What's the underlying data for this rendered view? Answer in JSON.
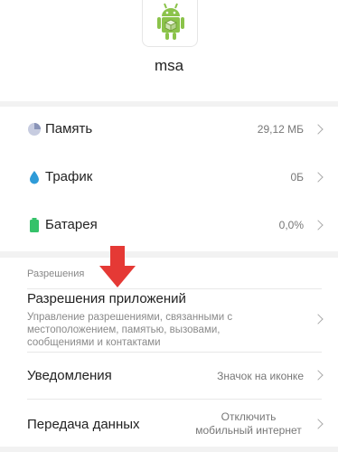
{
  "app": {
    "name": "msa",
    "icon": "android-icon"
  },
  "storage_rows": [
    {
      "label": "Память",
      "value": "29,12 МБ",
      "icon": "pie-chart-icon",
      "color": "#8a94b8"
    },
    {
      "label": "Трафик",
      "value": "0Б",
      "icon": "drop-icon",
      "color": "#2e9bd8"
    },
    {
      "label": "Батарея",
      "value": "0,0%",
      "icon": "battery-icon",
      "color": "#35c26a"
    }
  ],
  "permissions": {
    "section_title": "Разрешения",
    "title": "Разрешения приложений",
    "description": "Управление разрешениями, связанными с местоположением, памятью, вызовами, сообщениями и контактами"
  },
  "notifications": {
    "label": "Уведомления",
    "value": "Значок на иконке"
  },
  "data_transfer": {
    "label": "Передача данных",
    "value": "Отключить мобильный интернет"
  },
  "annotation_color": "#e53935"
}
